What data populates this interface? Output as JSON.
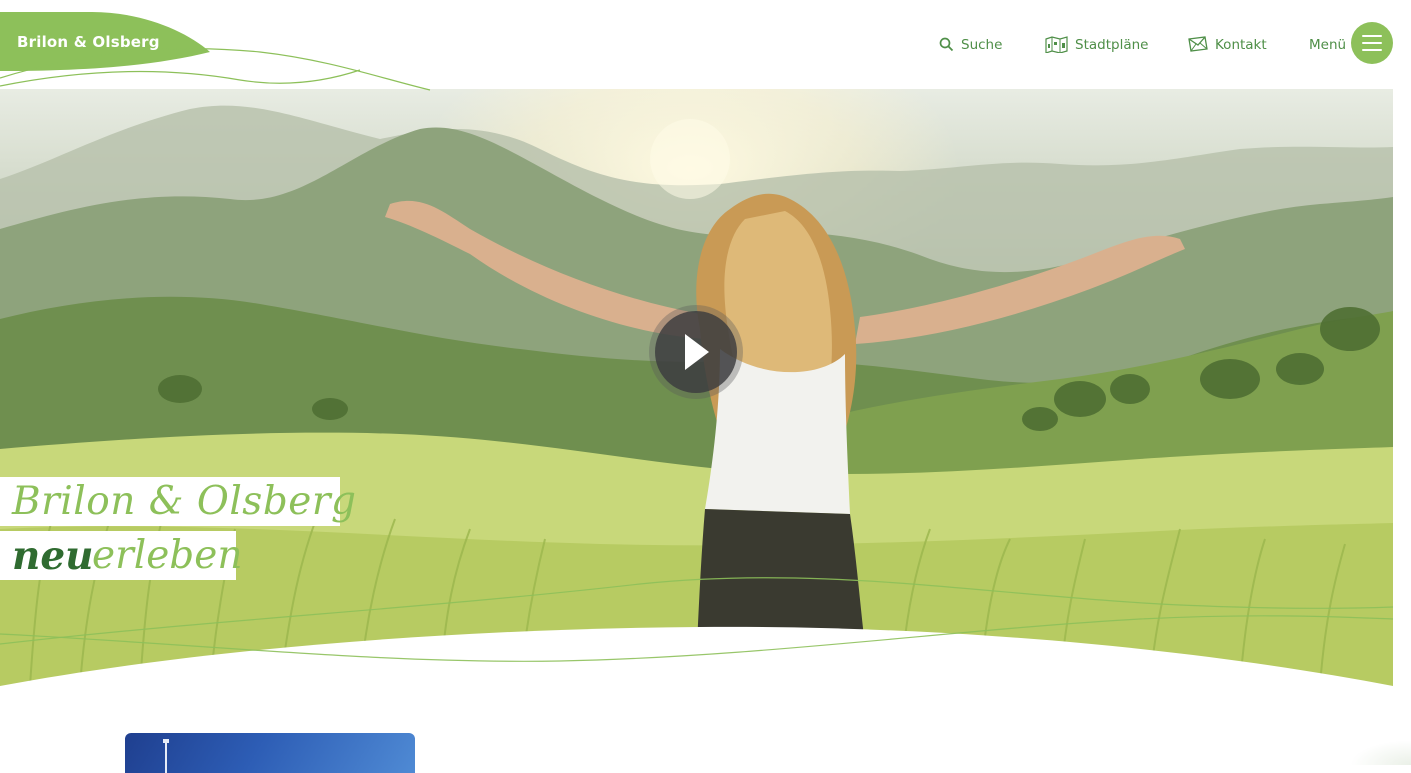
{
  "brand": {
    "logo_text": "Brilon & Olsberg",
    "accent_color": "#8dc05a",
    "dark_green": "#2f6b30",
    "nav_text_color": "#4f8f48"
  },
  "nav": {
    "search": {
      "label": "Suche",
      "icon": "search-icon"
    },
    "maps": {
      "label": "Stadtpläne",
      "icon": "map-icon"
    },
    "contact": {
      "label": "Kontakt",
      "icon": "envelope-icon"
    },
    "menu": {
      "label": "Menü",
      "icon": "hamburger-icon"
    }
  },
  "hero": {
    "headline_line1": "Brilon & Olsberg",
    "headline_line2_part1": "neu",
    "headline_line2_part2": "erleben",
    "play_icon": "play-icon",
    "image_description_icon": "hero-image"
  }
}
